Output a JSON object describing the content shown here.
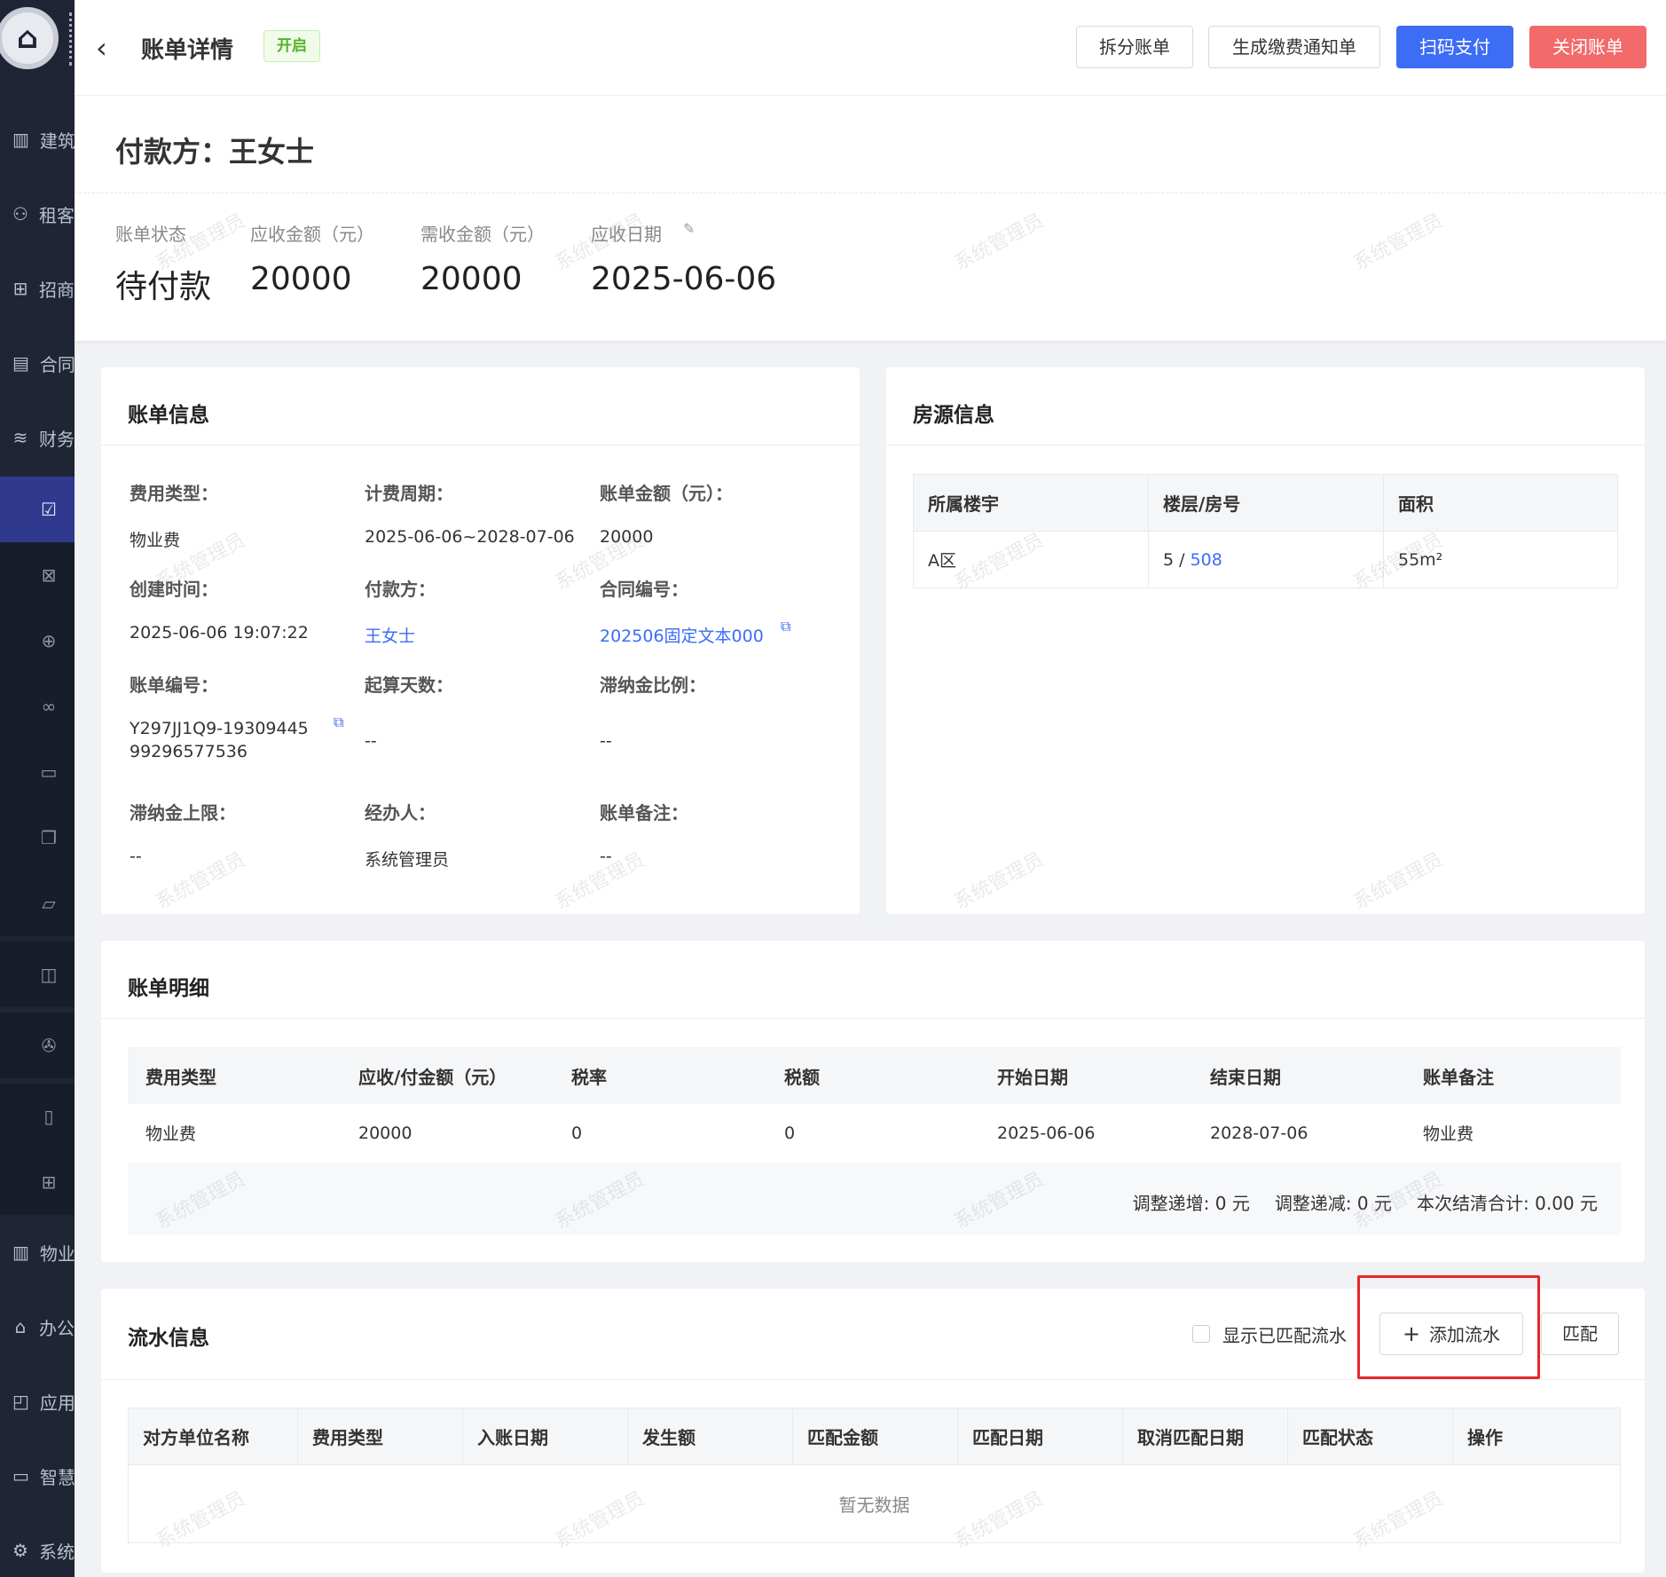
{
  "sidebar": {
    "items": [
      {
        "icon": "building-icon",
        "label": "建筑"
      },
      {
        "icon": "user-icon",
        "label": "租客"
      },
      {
        "icon": "briefcase-plus-icon",
        "label": "招商"
      },
      {
        "icon": "document-icon",
        "label": "合同"
      },
      {
        "icon": "database-icon",
        "label": "财务"
      }
    ],
    "items_bottom": [
      {
        "icon": "building-icon",
        "label": "物业"
      },
      {
        "icon": "home-icon",
        "label": "办公"
      },
      {
        "icon": "app-icon",
        "label": "应用"
      },
      {
        "icon": "monitor-icon",
        "label": "智慧"
      },
      {
        "icon": "gear-icon",
        "label": "系统"
      }
    ]
  },
  "header": {
    "title": "账单详情",
    "status_tag": "开启",
    "buttons": {
      "split": "拆分账单",
      "notice": "生成缴费通知单",
      "scan_pay": "扫码支付",
      "close": "关闭账单"
    }
  },
  "payer": {
    "title": "付款方：王女士"
  },
  "summary": {
    "status_label": "账单状态",
    "status_value": "待付款",
    "receivable_label": "应收金额（元）",
    "receivable_value": "20000",
    "due_label": "需收金额（元）",
    "due_value": "20000",
    "date_label": "应收日期",
    "date_value": "2025-06-06"
  },
  "bill_info": {
    "title": "账单信息",
    "fields": {
      "fee_type_label": "费用类型：",
      "fee_type_value": "物业费",
      "period_label": "计费周期：",
      "period_value": "2025-06-06~2028-07-06",
      "amount_label": "账单金额（元）：",
      "amount_value": "20000",
      "created_label": "创建时间：",
      "created_value": "2025-06-06 19:07:22",
      "payer_label": "付款方：",
      "payer_value": "王女士",
      "contract_label": "合同编号：",
      "contract_value": "202506固定文本000",
      "bill_no_label": "账单编号：",
      "bill_no_value_1": "Y297JJ1Q9-19309445",
      "bill_no_value_2": "99296577536",
      "start_days_label": "起算天数：",
      "start_days_value": "--",
      "late_ratio_label": "滞纳金比例：",
      "late_ratio_value": "--",
      "late_cap_label": "滞纳金上限：",
      "late_cap_value": "--",
      "handler_label": "经办人：",
      "handler_value": "系统管理员",
      "remark_label": "账单备注：",
      "remark_value": "--"
    }
  },
  "property_info": {
    "title": "房源信息",
    "headers": [
      "所属楼宇",
      "楼层/房号",
      "面积"
    ],
    "row": {
      "building": "A区",
      "floor": "5 / ",
      "room": "508",
      "area": "55m²"
    }
  },
  "bill_detail": {
    "title": "账单明细",
    "headers": [
      "费用类型",
      "应收/付金额（元）",
      "税率",
      "税额",
      "开始日期",
      "结束日期",
      "账单备注"
    ],
    "rows": [
      [
        "物业费",
        "20000",
        "0",
        "0",
        "2025-06-06",
        "2028-07-06",
        "物业费"
      ]
    ],
    "totals": {
      "increase": "调整递增: 0 元",
      "decrease": "调整递减: 0 元",
      "settle": "本次结清合计: 0.00 元"
    }
  },
  "flow_info": {
    "title": "流水信息",
    "show_matched": "显示已匹配流水",
    "add_button": "添加流水",
    "match_button": "匹配",
    "headers": [
      "对方单位名称",
      "费用类型",
      "入账日期",
      "发生额",
      "匹配金额",
      "匹配日期",
      "取消匹配日期",
      "匹配状态",
      "操作"
    ],
    "empty": "暂无数据"
  },
  "watermark": "系统管理员",
  "colors": {
    "primary": "#3d6cf5",
    "danger": "#f26a6a",
    "sidebar": "#1f2535",
    "tag_green": "#52b227",
    "highlight": "#e5282a"
  }
}
